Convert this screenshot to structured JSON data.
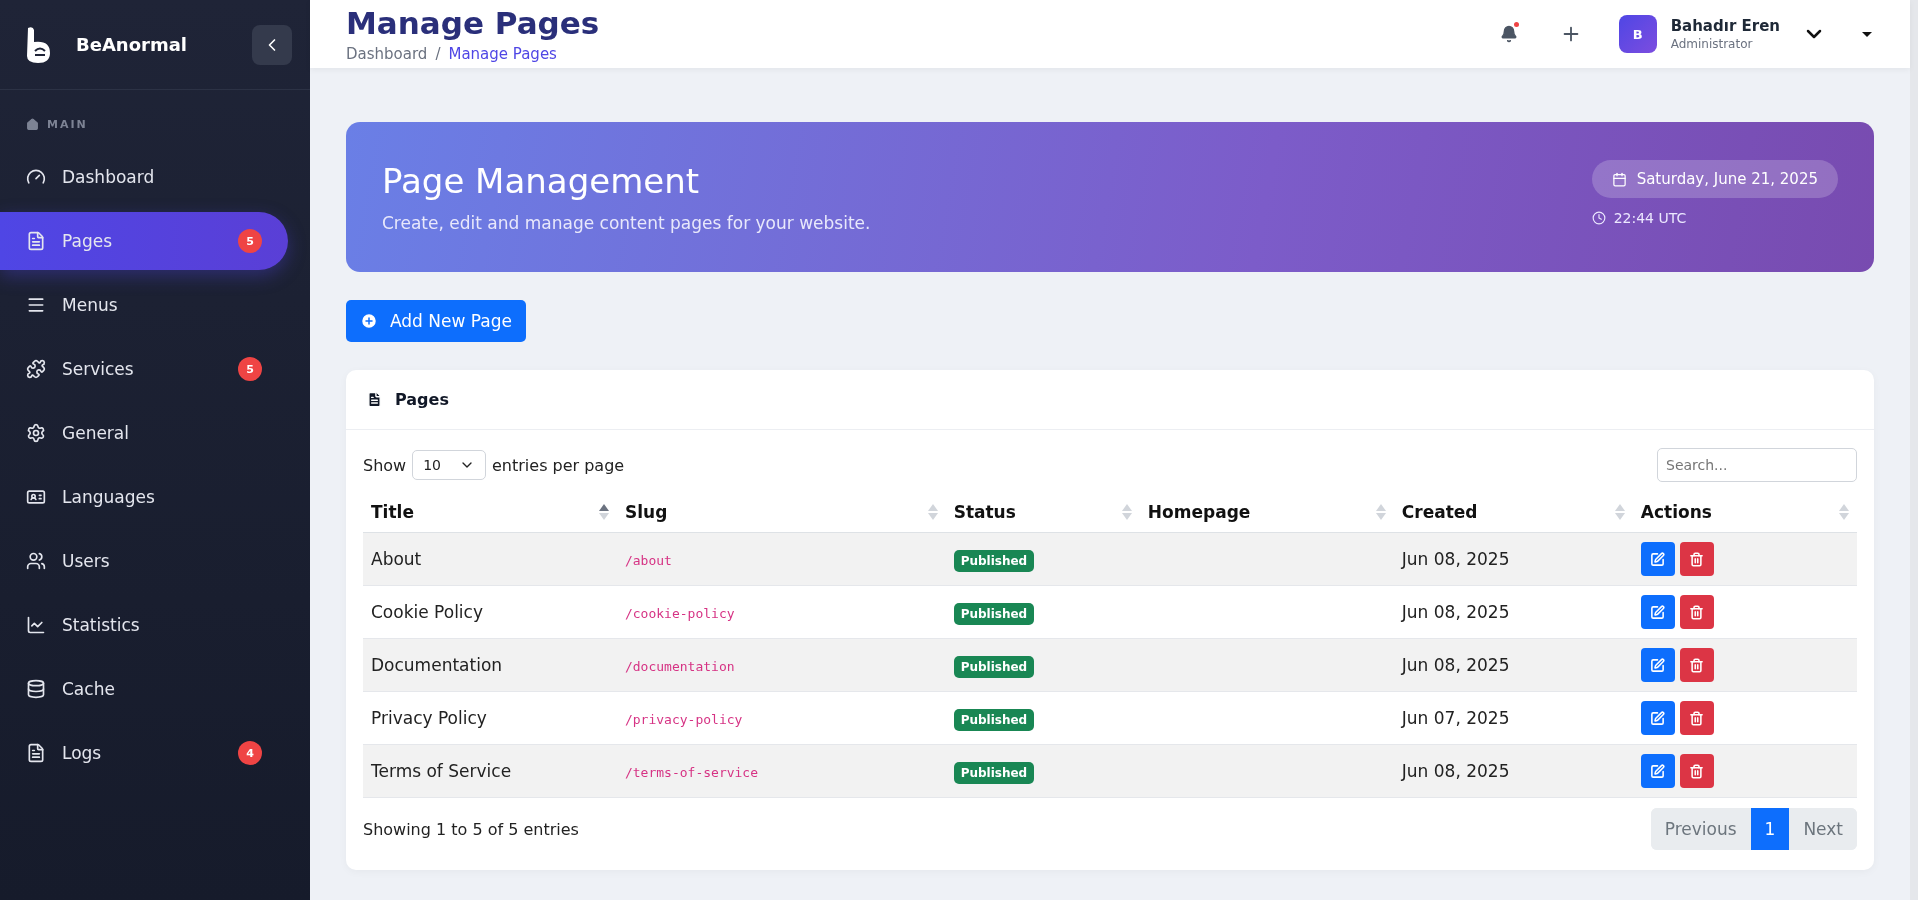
{
  "brand": {
    "name": "BeAnormal"
  },
  "sidebar": {
    "section": "MAIN",
    "items": [
      {
        "label": "Dashboard",
        "selected": false
      },
      {
        "label": "Pages",
        "selected": true,
        "badge": "5"
      },
      {
        "label": "Menus",
        "selected": false
      },
      {
        "label": "Services",
        "selected": false,
        "badge": "5"
      },
      {
        "label": "General",
        "selected": false
      },
      {
        "label": "Languages",
        "selected": false
      },
      {
        "label": "Users",
        "selected": false
      },
      {
        "label": "Statistics",
        "selected": false
      },
      {
        "label": "Cache",
        "selected": false
      },
      {
        "label": "Logs",
        "selected": false,
        "badge": "4"
      }
    ]
  },
  "header": {
    "title": "Manage Pages",
    "breadcrumb": [
      "Dashboard",
      "Manage Pages"
    ],
    "breadcrumb_separator": "/",
    "notifications_unread": true,
    "user": {
      "initial": "B",
      "name": "Bahadır Eren",
      "role": "Administrator"
    }
  },
  "banner": {
    "title": "Page Management",
    "subtitle": "Create, edit and manage content pages for your website.",
    "date": "Saturday, June 21, 2025",
    "time": "22:44 UTC"
  },
  "add_button": "Add New Page",
  "card": {
    "title": "Pages",
    "length": {
      "prefix": "Show",
      "value": "10",
      "suffix": "entries per page"
    },
    "search": {
      "placeholder": "Search..."
    },
    "columns": [
      {
        "label": "Title",
        "sorted": true
      },
      {
        "label": "Slug",
        "sorted": false
      },
      {
        "label": "Status",
        "sorted": false
      },
      {
        "label": "Homepage",
        "sorted": false
      },
      {
        "label": "Created",
        "sorted": false
      },
      {
        "label": "Actions",
        "sorted": false
      }
    ],
    "rows": [
      {
        "title": "About",
        "slug": "/about",
        "status": "Published",
        "created": "Jun 08, 2025"
      },
      {
        "title": "Cookie Policy",
        "slug": "/cookie-policy",
        "status": "Published",
        "created": "Jun 08, 2025"
      },
      {
        "title": "Documentation",
        "slug": "/documentation",
        "status": "Published",
        "created": "Jun 08, 2025"
      },
      {
        "title": "Privacy Policy",
        "slug": "/privacy-policy",
        "status": "Published",
        "created": "Jun 07, 2025"
      },
      {
        "title": "Terms of Service",
        "slug": "/terms-of-service",
        "status": "Published",
        "created": "Jun 08, 2025"
      }
    ],
    "info": "Showing 1 to 5 of 5 entries",
    "pagination": {
      "previous": "Previous",
      "pages": [
        {
          "label": "1",
          "selected": true
        }
      ],
      "next": "Next"
    }
  }
}
